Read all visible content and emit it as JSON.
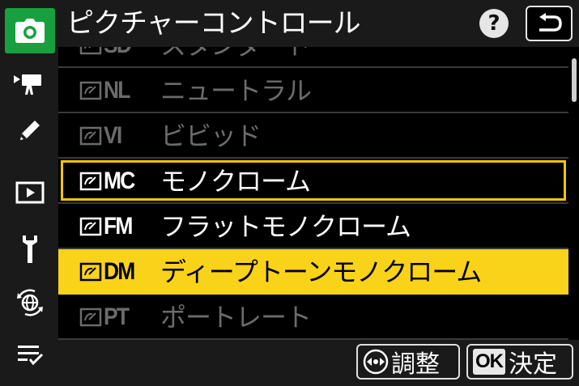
{
  "header": {
    "title": "ピクチャーコントロール",
    "help_label": "?"
  },
  "sidebar": {
    "items": [
      {
        "name": "camera-icon",
        "active": true
      },
      {
        "name": "movie-camera-icon",
        "active": false
      },
      {
        "name": "pencil-icon",
        "active": false
      },
      {
        "name": "playback-icon",
        "active": false
      },
      {
        "name": "wrench-icon",
        "active": false
      },
      {
        "name": "network-icon",
        "active": false
      },
      {
        "name": "my-menu-icon",
        "active": false
      }
    ]
  },
  "list": {
    "rows": [
      {
        "code": "SD",
        "label": "スタンダード",
        "state": "dim"
      },
      {
        "code": "NL",
        "label": "ニュートラル",
        "state": "dim"
      },
      {
        "code": "VI",
        "label": "ビビッド",
        "state": "dim"
      },
      {
        "code": "MC",
        "label": "モノクローム",
        "state": "focused"
      },
      {
        "code": "FM",
        "label": "フラットモノクローム",
        "state": "normal"
      },
      {
        "code": "DM",
        "label": "ディープトーンモノクローム",
        "state": "selected"
      },
      {
        "code": "PT",
        "label": "ポートレート",
        "state": "dim"
      }
    ]
  },
  "footer": {
    "adjust_label": "調整",
    "ok_badge": "OK",
    "ok_label": "決定"
  },
  "colors": {
    "accent_green": "#18a040",
    "selection_yellow": "#f9d21a",
    "focus_yellow": "#f5c400"
  }
}
